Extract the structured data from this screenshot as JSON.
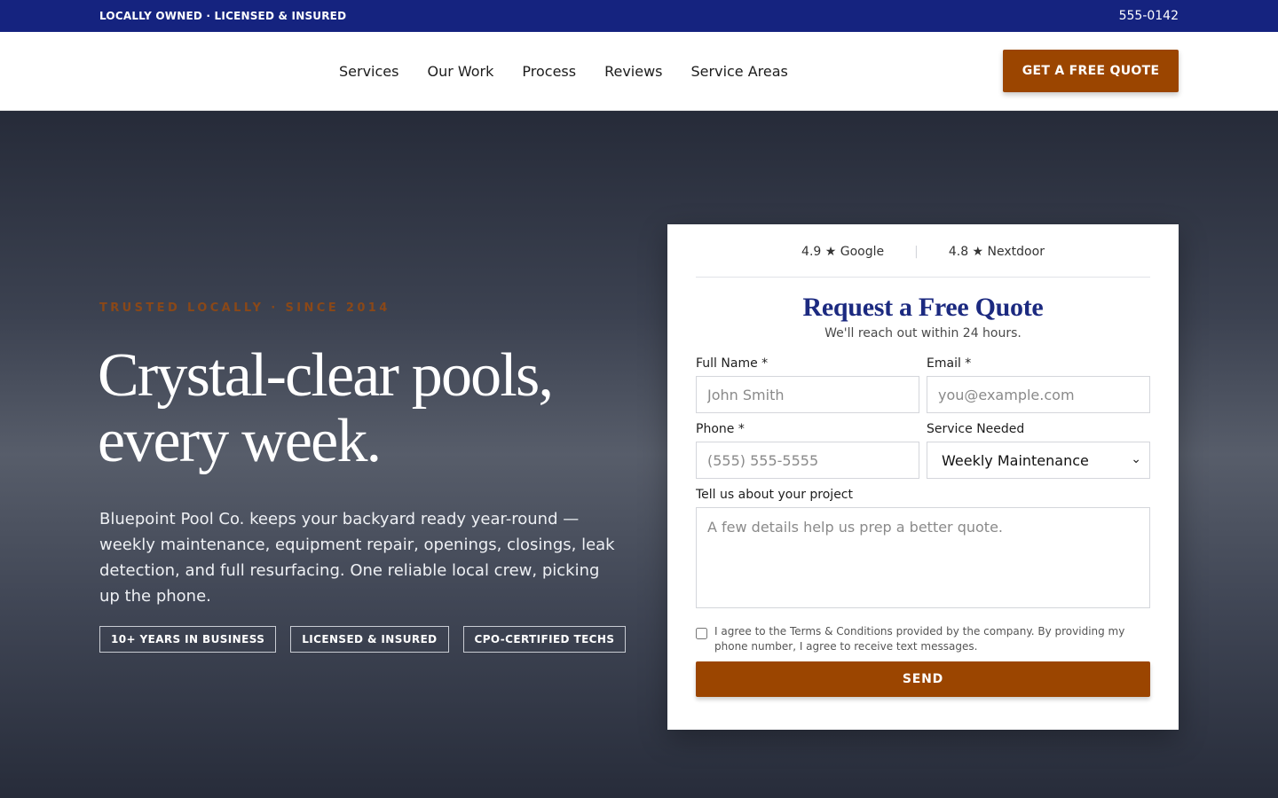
{
  "topbar": {
    "tagline": "LOCALLY OWNED · LICENSED & INSURED",
    "phone": "555-0142"
  },
  "nav": {
    "links": [
      "Services",
      "Our Work",
      "Process",
      "Reviews",
      "Service Areas"
    ],
    "cta_label": "GET A FREE QUOTE"
  },
  "hero": {
    "eyebrow": "TRUSTED LOCALLY · SINCE 2014",
    "headline": "Crystal-clear pools, every week.",
    "intro": "Bluepoint Pool Co. keeps your backyard ready year-round — weekly maintenance, equipment repair, openings, closings, leak detection, and full resurfacing. One reliable local crew, picking up the phone.",
    "badges": [
      "10+ YEARS IN BUSINESS",
      "LICENSED & INSURED",
      "CPO-CERTIFIED TECHS"
    ]
  },
  "form": {
    "ratings": [
      "4.9 ★ Google",
      "4.8 ★ Nextdoor"
    ],
    "title": "Request a Free Quote",
    "subtitle": "We'll reach out within 24 hours.",
    "name_label": "Full Name *",
    "name_placeholder": "John Smith",
    "email_label": "Email *",
    "email_placeholder": "you@example.com",
    "phone_label": "Phone *",
    "phone_placeholder": "(555) 555-5555",
    "service_label": "Service Needed",
    "service_value": "Weekly Maintenance",
    "project_label": "Tell us about your project",
    "project_placeholder": "A few details help us prep a better quote.",
    "consent": "I agree to the Terms & Conditions provided by the company. By providing my phone number, I agree to receive text messages.",
    "send_label": "SEND"
  },
  "colors": {
    "brand_navy": "#15237f",
    "accent_orange": "#9b4500",
    "title_blue": "#1c2a80"
  }
}
